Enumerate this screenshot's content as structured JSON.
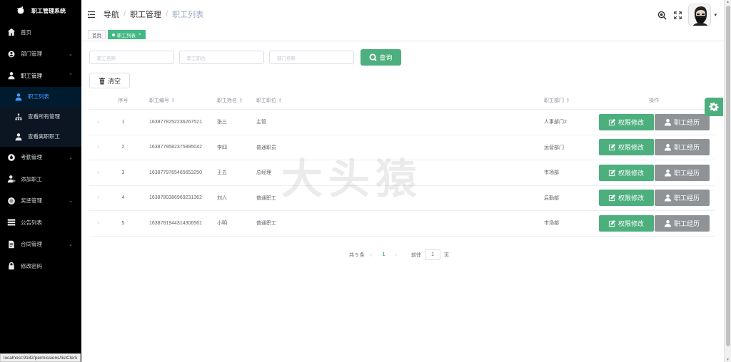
{
  "app": {
    "title": "职工管理系统"
  },
  "sidebar": {
    "items": [
      {
        "label": "首页",
        "icon": "home-icon",
        "has_arrow": false
      },
      {
        "label": "部门管理",
        "icon": "dept-icon",
        "has_arrow": true,
        "arrow": "⌄"
      },
      {
        "label": "职工管理",
        "icon": "user-icon",
        "has_arrow": true,
        "arrow": "⌃",
        "expanded": true
      },
      {
        "label": "考勤管理",
        "icon": "attendance-icon",
        "has_arrow": true,
        "arrow": "⌄"
      },
      {
        "label": "添加职工",
        "icon": "add-user-icon",
        "has_arrow": false
      },
      {
        "label": "奖惩管理",
        "icon": "award-icon",
        "has_arrow": true,
        "arrow": "⌄"
      },
      {
        "label": "公告列表",
        "icon": "list-icon",
        "has_arrow": false
      },
      {
        "label": "合同管理",
        "icon": "contract-icon",
        "has_arrow": true,
        "arrow": "⌄"
      },
      {
        "label": "修改密码",
        "icon": "lock-icon",
        "has_arrow": false
      }
    ],
    "sub_items": [
      {
        "label": "职工列表",
        "icon": "user-icon",
        "current": true
      },
      {
        "label": "查看所有管理",
        "icon": "org-icon",
        "current": false
      },
      {
        "label": "查看离职职工",
        "icon": "user-icon",
        "current": false
      }
    ]
  },
  "header": {
    "breadcrumb": [
      "导航",
      "职工管理",
      "职工列表"
    ]
  },
  "tags": {
    "home": "首页",
    "active": "职工列表",
    "close": "×"
  },
  "filters": {
    "name_placeholder": "职工名称",
    "position_placeholder": "职工职位",
    "dept_placeholder": "部门名称",
    "query_label": "查询",
    "clear_label": "清空"
  },
  "table": {
    "headers": {
      "no": "序号",
      "id": "职工编号",
      "name": "职工姓名",
      "position": "职工职位",
      "dept": "职工部门",
      "ops": "操作"
    },
    "rows": [
      {
        "no": "1",
        "id": "1638778252236267521",
        "name": "张三",
        "position": "主管",
        "dept": "人事部门2"
      },
      {
        "no": "2",
        "id": "1638779582375895042",
        "name": "李四",
        "position": "普通职员",
        "dept": "运营部门"
      },
      {
        "no": "3",
        "id": "1638779765465653250",
        "name": "王五",
        "position": "总经理",
        "dept": "市场部"
      },
      {
        "no": "4",
        "id": "1638780386969231362",
        "name": "刘六",
        "position": "普通职工",
        "dept": "后勤部"
      },
      {
        "no": "5",
        "id": "1638781944314306561",
        "name": "小明",
        "position": "普通职工",
        "dept": "市场部"
      }
    ],
    "perm_label": "权限修改",
    "hist_label": "职工经历",
    "expand_glyph": "›"
  },
  "pager": {
    "total": "共 5 条",
    "prev": "‹",
    "page": "1",
    "next": "›",
    "goto_prefix": "前往",
    "goto_value": "1",
    "goto_suffix": "页"
  },
  "watermark": "大头猿",
  "status_url": "localhost:9182/permissions/listClerk",
  "colors": {
    "accent": "#4caf7d",
    "sidebar_bg": "#000000",
    "current_menu": "#409eff",
    "history_button": "#8f9396"
  }
}
